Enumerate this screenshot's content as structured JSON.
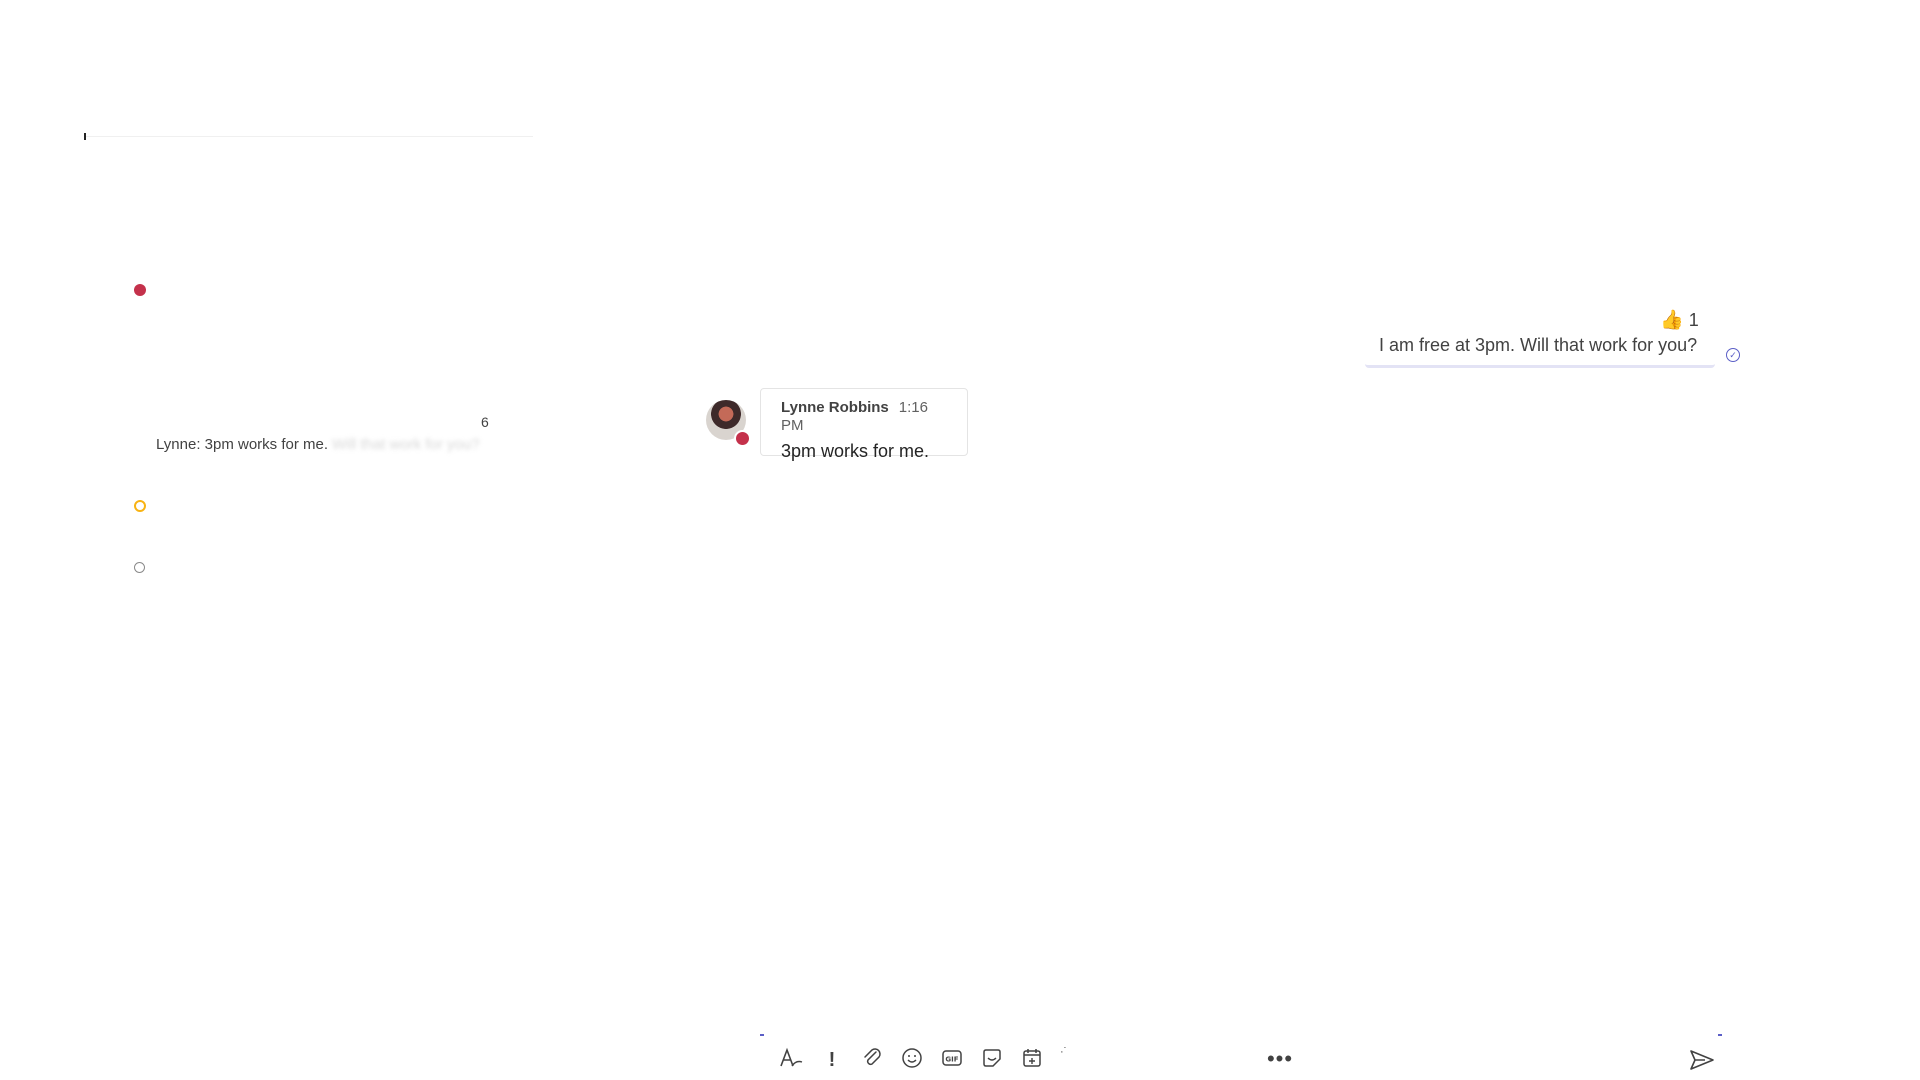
{
  "sidebar": {
    "chat_preview": "Lynne: 3pm works for me.",
    "chat_preview_faded": "Will that work for you?",
    "unread_count": "6"
  },
  "conversation": {
    "outgoing": {
      "text": "I am free at 3pm. Will that work for you?",
      "reaction_emoji": "👍",
      "reaction_count": "1"
    },
    "incoming": {
      "sender": "Lynne Robbins",
      "time": "1:16 PM",
      "text": "3pm works for me."
    }
  },
  "compose": {
    "icons": [
      "format-icon",
      "important-icon",
      "attach-icon",
      "emoji-icon",
      "gif-icon",
      "sticker-icon",
      "schedule-meeting-icon"
    ],
    "more_label": "•••"
  },
  "colors": {
    "accent": "#5b5fc7",
    "busy": "#c4314b",
    "away": "#f8b313"
  }
}
